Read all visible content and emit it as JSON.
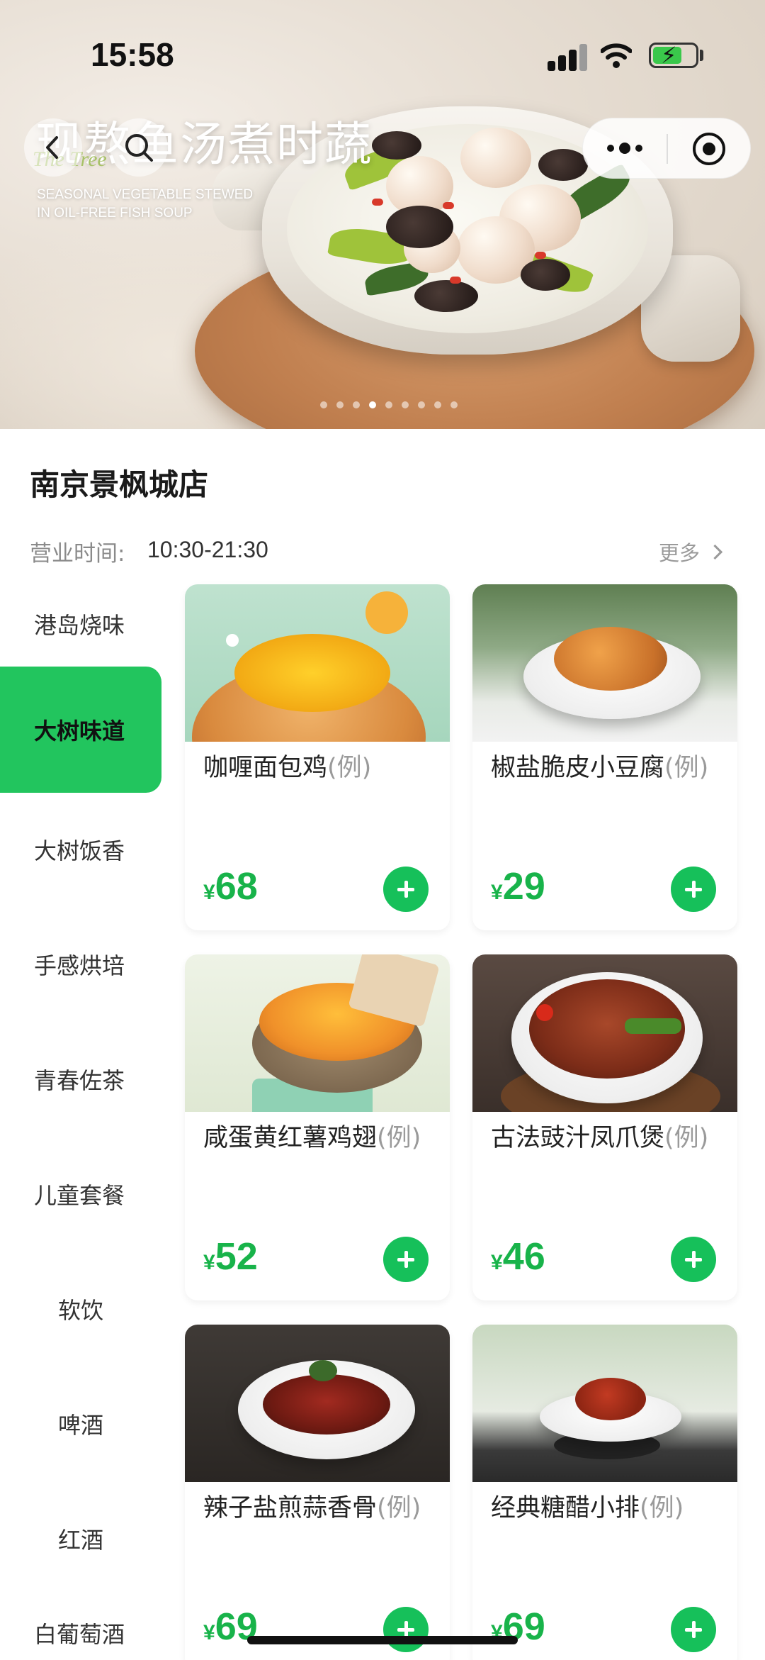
{
  "status_bar": {
    "time": "15:58"
  },
  "hero": {
    "title": "现熬鱼汤煮时蔬",
    "script_text": "The Tree",
    "subtitle": "SEASONAL VEGETABLE STEWED IN OIL-FREE FISH SOUP",
    "page_count": 9,
    "active_page": 4
  },
  "nav": {
    "back": "back-icon",
    "search": "search-icon",
    "menu": "more-dots-icon",
    "close": "target-icon"
  },
  "store": {
    "name": "南京景枫城店",
    "hours_label": "营业时间:",
    "hours_value": "10:30-21:30",
    "more_label": "更多"
  },
  "categories": [
    {
      "label": "港岛烧味",
      "active": false
    },
    {
      "label": "大树味道",
      "active": true
    },
    {
      "label": "大树饭香",
      "active": false
    },
    {
      "label": "手感烘培",
      "active": false
    },
    {
      "label": "青春佐茶",
      "active": false
    },
    {
      "label": "儿童套餐",
      "active": false
    },
    {
      "label": "软饮",
      "active": false
    },
    {
      "label": "啤酒",
      "active": false
    },
    {
      "label": "红酒",
      "active": false
    },
    {
      "label": "白葡萄酒",
      "active": false
    }
  ],
  "products": [
    {
      "name": "咖喱面包鸡",
      "unit": "(例)",
      "currency": "¥",
      "price": "68"
    },
    {
      "name": "椒盐脆皮小豆腐",
      "unit": "(例)",
      "currency": "¥",
      "price": "29"
    },
    {
      "name": "咸蛋黄红薯鸡翅",
      "unit": "(例)",
      "currency": "¥",
      "price": "52"
    },
    {
      "name": "古法豉汁凤爪煲",
      "unit": "(例)",
      "currency": "¥",
      "price": "46"
    },
    {
      "name": "辣子盐煎蒜香骨",
      "unit": "(例)",
      "currency": "¥",
      "price": "69"
    },
    {
      "name": "经典糖醋小排",
      "unit": "(例)",
      "currency": "¥",
      "price": "69"
    }
  ],
  "colors": {
    "accent": "#22c55e",
    "price": "#18b34a",
    "add_button": "#16c05a"
  }
}
